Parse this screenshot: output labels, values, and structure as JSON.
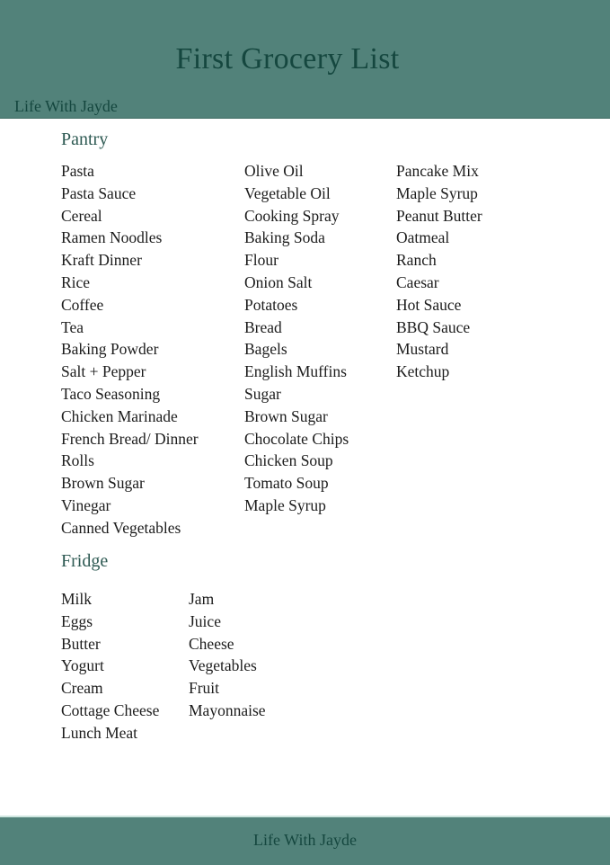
{
  "header": {
    "title": "First Grocery List",
    "brand": "Life With Jayde"
  },
  "sections": {
    "pantry": {
      "title": "Pantry",
      "columns": [
        [
          "Pasta",
          "Pasta Sauce",
          "Cereal",
          "Ramen Noodles",
          "Kraft Dinner",
          "Rice",
          "Coffee",
          "Tea",
          "Baking Powder",
          "Salt + Pepper",
          "Taco Seasoning",
          "Chicken Marinade",
          "French Bread/ Dinner",
          "Rolls",
          "Brown Sugar",
          "Vinegar",
          "Canned Vegetables"
        ],
        [
          "Olive Oil",
          "Vegetable Oil",
          "Cooking Spray",
          "Baking Soda",
          "Flour",
          "Onion Salt",
          "Potatoes",
          "Bread",
          "Bagels",
          "English Muffins",
          "Sugar",
          "Brown Sugar",
          "Chocolate Chips",
          "Chicken Soup",
          "Tomato Soup",
          "Maple Syrup"
        ],
        [
          "Pancake Mix",
          "Maple Syrup",
          "Peanut Butter",
          "Oatmeal",
          "Ranch",
          "Caesar",
          "Hot Sauce",
          "BBQ Sauce",
          "Mustard",
          "Ketchup"
        ]
      ]
    },
    "fridge": {
      "title": "Fridge",
      "columns": [
        [
          "Milk",
          "Eggs",
          "Butter",
          "Yogurt",
          "Cream",
          "Cottage Cheese",
          "Lunch Meat"
        ],
        [
          "Jam",
          "Juice",
          "Cheese",
          "Vegetables",
          "Fruit",
          "Mayonnaise"
        ]
      ]
    }
  },
  "footer": {
    "text": "Life With Jayde"
  },
  "colors": {
    "band": "#52827a",
    "heading_text": "#15473f",
    "section_title": "#2e5a53",
    "body_text": "#1c1c1c"
  }
}
